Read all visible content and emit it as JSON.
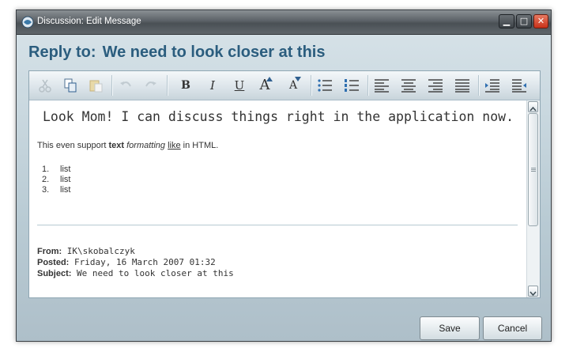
{
  "window": {
    "title": "Discussion: Edit Message"
  },
  "heading": {
    "prefix": "Reply to:",
    "subject": "We need to look closer at this"
  },
  "editor": {
    "title_line": "Look Mom! I can discuss things right in the application now.",
    "paragraph": {
      "t1": "This even support ",
      "bold": "text",
      "t2": " ",
      "italic": "formatting",
      "t3": " ",
      "underline": "like",
      "t4": " in HTML."
    },
    "list": [
      {
        "num": "1.",
        "text": "list"
      },
      {
        "num": "2.",
        "text": "list"
      },
      {
        "num": "3.",
        "text": "list"
      }
    ],
    "meta": {
      "from_label": "From:",
      "from_value": " IK\\skobalczyk",
      "posted_label": "Posted:",
      "posted_value": " Friday, 16 March 2007 01:32",
      "subject_label": "Subject:",
      "subject_value": " We need to look closer at this"
    }
  },
  "toolbar": {
    "bold": "B",
    "italic": "I",
    "underline": "U",
    "grow": "A",
    "shrink": "A"
  },
  "buttons": {
    "save": "Save",
    "cancel": "Cancel"
  },
  "colors": {
    "heading": "#2b5d7e",
    "title_bar": "#4a5055",
    "close": "#c8321a"
  }
}
